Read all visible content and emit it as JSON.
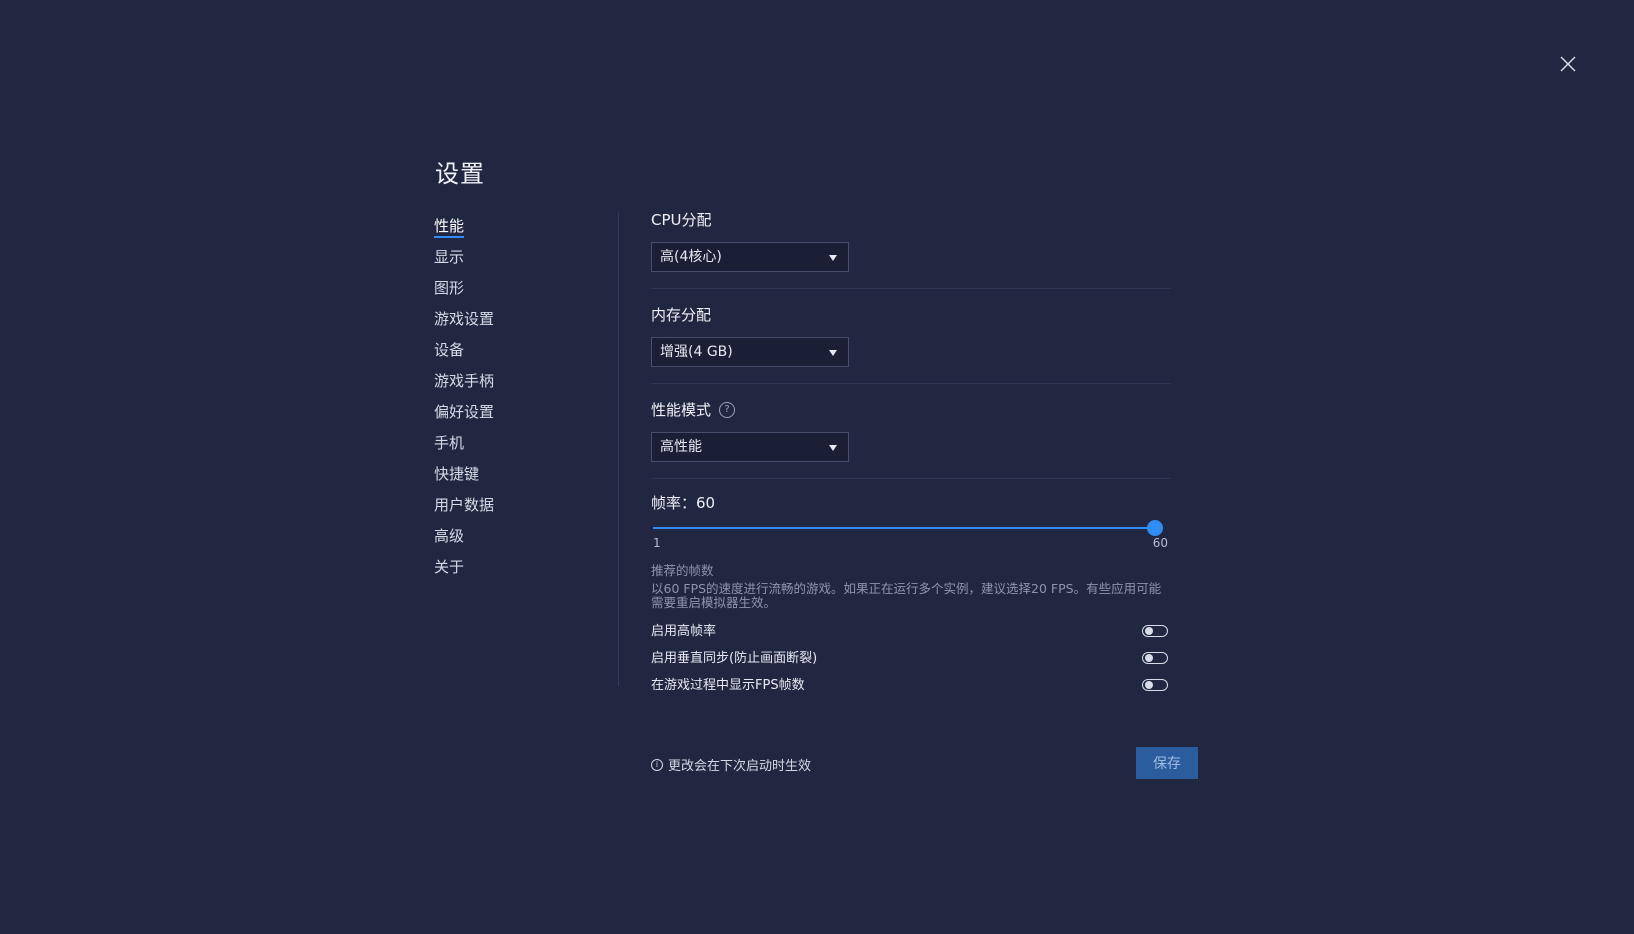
{
  "dialog": {
    "title": "设置",
    "close_icon": "close-icon"
  },
  "sidebar": {
    "items": [
      {
        "label": "性能",
        "active": true
      },
      {
        "label": "显示",
        "active": false
      },
      {
        "label": "图形",
        "active": false
      },
      {
        "label": "游戏设置",
        "active": false
      },
      {
        "label": "设备",
        "active": false
      },
      {
        "label": "游戏手柄",
        "active": false
      },
      {
        "label": "偏好设置",
        "active": false
      },
      {
        "label": "手机",
        "active": false
      },
      {
        "label": "快捷键",
        "active": false
      },
      {
        "label": "用户数据",
        "active": false
      },
      {
        "label": "高级",
        "active": false
      },
      {
        "label": "关于",
        "active": false
      }
    ]
  },
  "performance": {
    "cpu": {
      "label": "CPU分配",
      "value": "高(4核心)"
    },
    "memory": {
      "label": "内存分配",
      "value": "增强(4 GB)"
    },
    "mode": {
      "label": "性能模式",
      "value": "高性能",
      "help_icon": "question-circle-icon"
    },
    "fps": {
      "label": "帧率：60",
      "value": 60,
      "min": 1,
      "max": 60,
      "min_label": "1",
      "max_label": "60",
      "hint_title": "推荐的帧数",
      "hint_body": "以60 FPS的速度进行流畅的游戏。如果正在运行多个实例，建议选择20 FPS。有些应用可能需要重启模拟器生效。"
    },
    "toggles": [
      {
        "label": "启用高帧率",
        "on": false
      },
      {
        "label": "启用垂直同步(防止画面断裂)",
        "on": false
      },
      {
        "label": "在游戏过程中显示FPS帧数",
        "on": false
      }
    ]
  },
  "footer": {
    "note": "更改会在下次启动时生效",
    "info_icon": "info-circle-icon",
    "save_label": "保存"
  },
  "colors": {
    "background": "#222741",
    "accent": "#2f8df5",
    "save_button": "#2b5c9e"
  }
}
